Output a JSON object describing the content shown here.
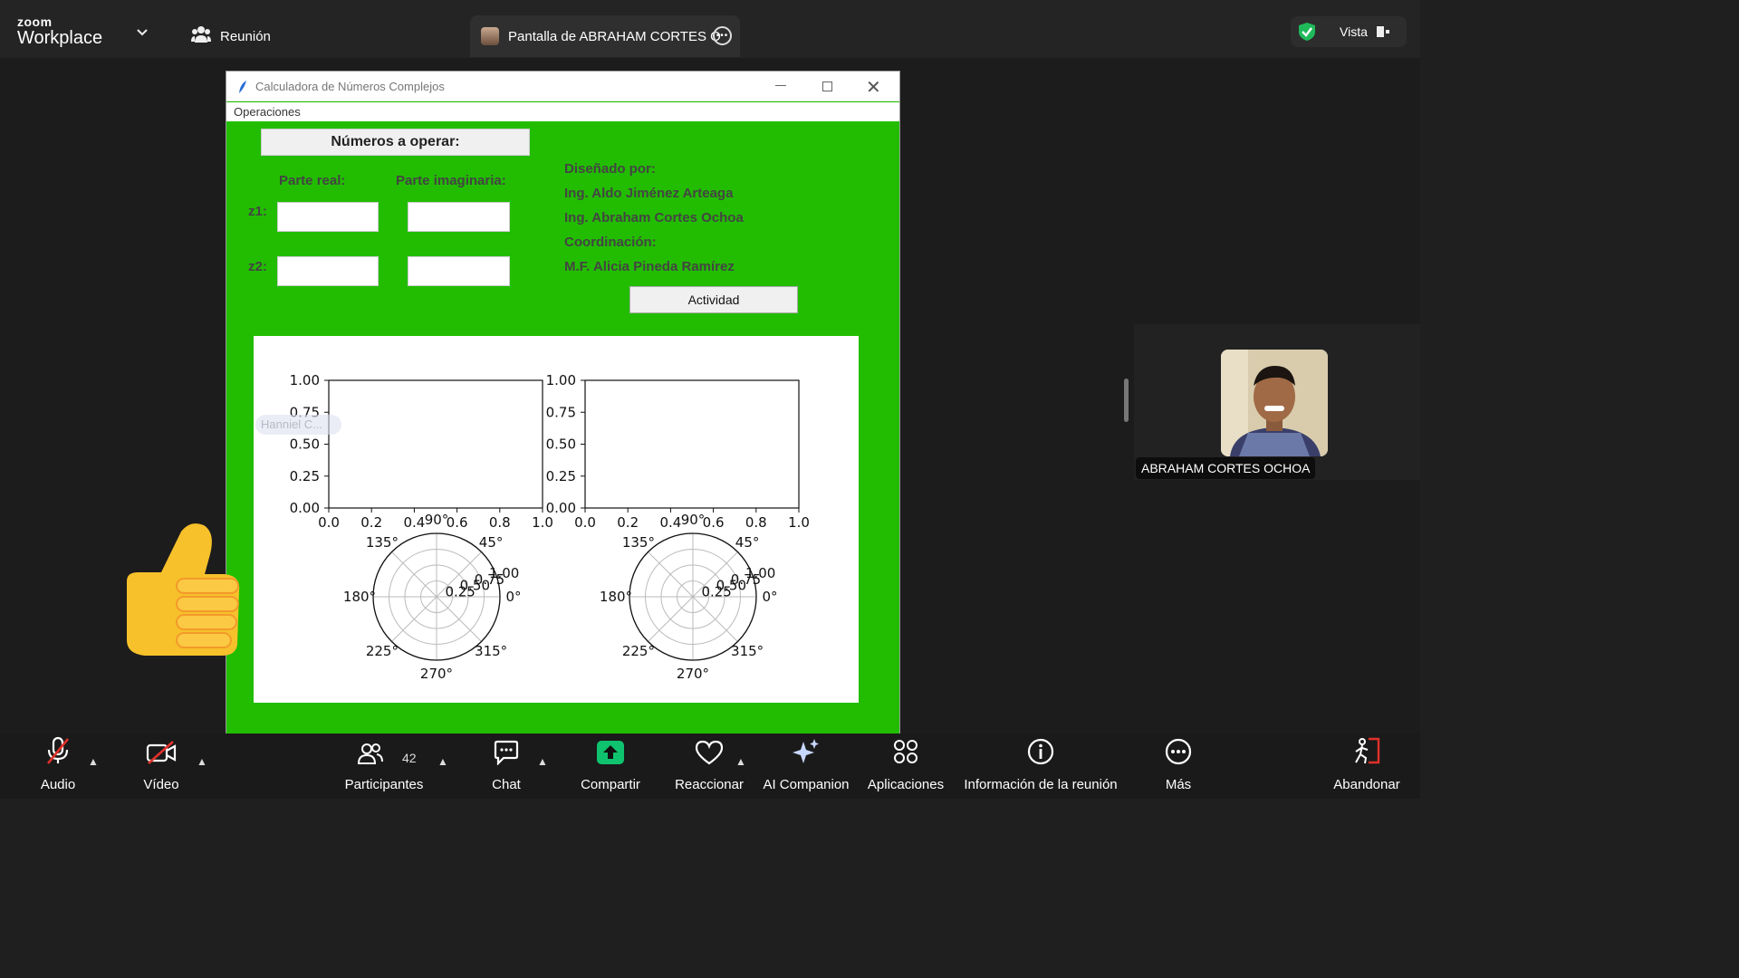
{
  "topbar": {
    "logo_small": "zoom",
    "logo_big": "Workplace",
    "meeting_label": "Reunión",
    "share_tab_label": "Pantalla de ABRAHAM CORTES O",
    "view_label": "Vista"
  },
  "app": {
    "window_title": "Calculadora de Números Complejos",
    "menu_operations": "Operaciones",
    "header": "Números a operar:",
    "col_real": "Parte real:",
    "col_imag": "Parte imaginaria:",
    "z1_label": "z1:",
    "z2_label": "z2:",
    "z1_real": "",
    "z1_imag": "",
    "z2_real": "",
    "z2_imag": "",
    "credits": {
      "designed_by": "Diseñado por:",
      "author1": "Ing. Aldo Jiménez Arteaga",
      "author2": "Ing. Abraham Cortes Ochoa",
      "coordination": "Coordinación:",
      "coordinator": "M.F. Alicia Pineda Ramírez"
    },
    "activity_button": "Actividad"
  },
  "chart_data": [
    {
      "type": "scatter",
      "title": "",
      "xlabel": "",
      "ylabel": "",
      "xlim": [
        0,
        1
      ],
      "ylim": [
        0,
        1
      ],
      "xticks": [
        "0.0",
        "0.2",
        "0.4",
        "0.6",
        "0.8",
        "1.0"
      ],
      "yticks": [
        "0.00",
        "0.25",
        "0.50",
        "0.75",
        "1.00"
      ],
      "series": []
    },
    {
      "type": "scatter",
      "title": "",
      "xlabel": "",
      "ylabel": "",
      "xlim": [
        0,
        1
      ],
      "ylim": [
        0,
        1
      ],
      "xticks": [
        "0.0",
        "0.2",
        "0.4",
        "0.6",
        "0.8",
        "1.0"
      ],
      "yticks": [
        "0.00",
        "0.25",
        "0.50",
        "0.75",
        "1.00"
      ],
      "series": []
    },
    {
      "type": "polar",
      "angle_ticks": [
        "0°",
        "45°",
        "90°",
        "135°",
        "180°",
        "225°",
        "270°",
        "315°"
      ],
      "radial_ticks": [
        "0.25",
        "0.50",
        "0.75",
        "1.00"
      ],
      "series": []
    },
    {
      "type": "polar",
      "angle_ticks": [
        "0°",
        "45°",
        "90°",
        "135°",
        "180°",
        "225°",
        "270°",
        "315°"
      ],
      "radial_ticks": [
        "0.25",
        "0.50",
        "0.75",
        "1.00"
      ],
      "series": []
    }
  ],
  "overlay": {
    "ghost_name": "Hanniel C...",
    "participant_name": "ABRAHAM CORTES OCHOA"
  },
  "toolbar": {
    "audio": "Audio",
    "video": "Vídeo",
    "participants": "Participantes",
    "participant_count": "42",
    "chat": "Chat",
    "share": "Compartir",
    "react": "Reaccionar",
    "ai": "AI Companion",
    "apps": "Aplicaciones",
    "info": "Información de la reunión",
    "more": "Más",
    "leave": "Abandonar"
  },
  "colors": {
    "app_green": "#22bd00",
    "share_green": "#0fc26e",
    "leave_red": "#e0312b",
    "shield_green": "#1fb95a"
  }
}
